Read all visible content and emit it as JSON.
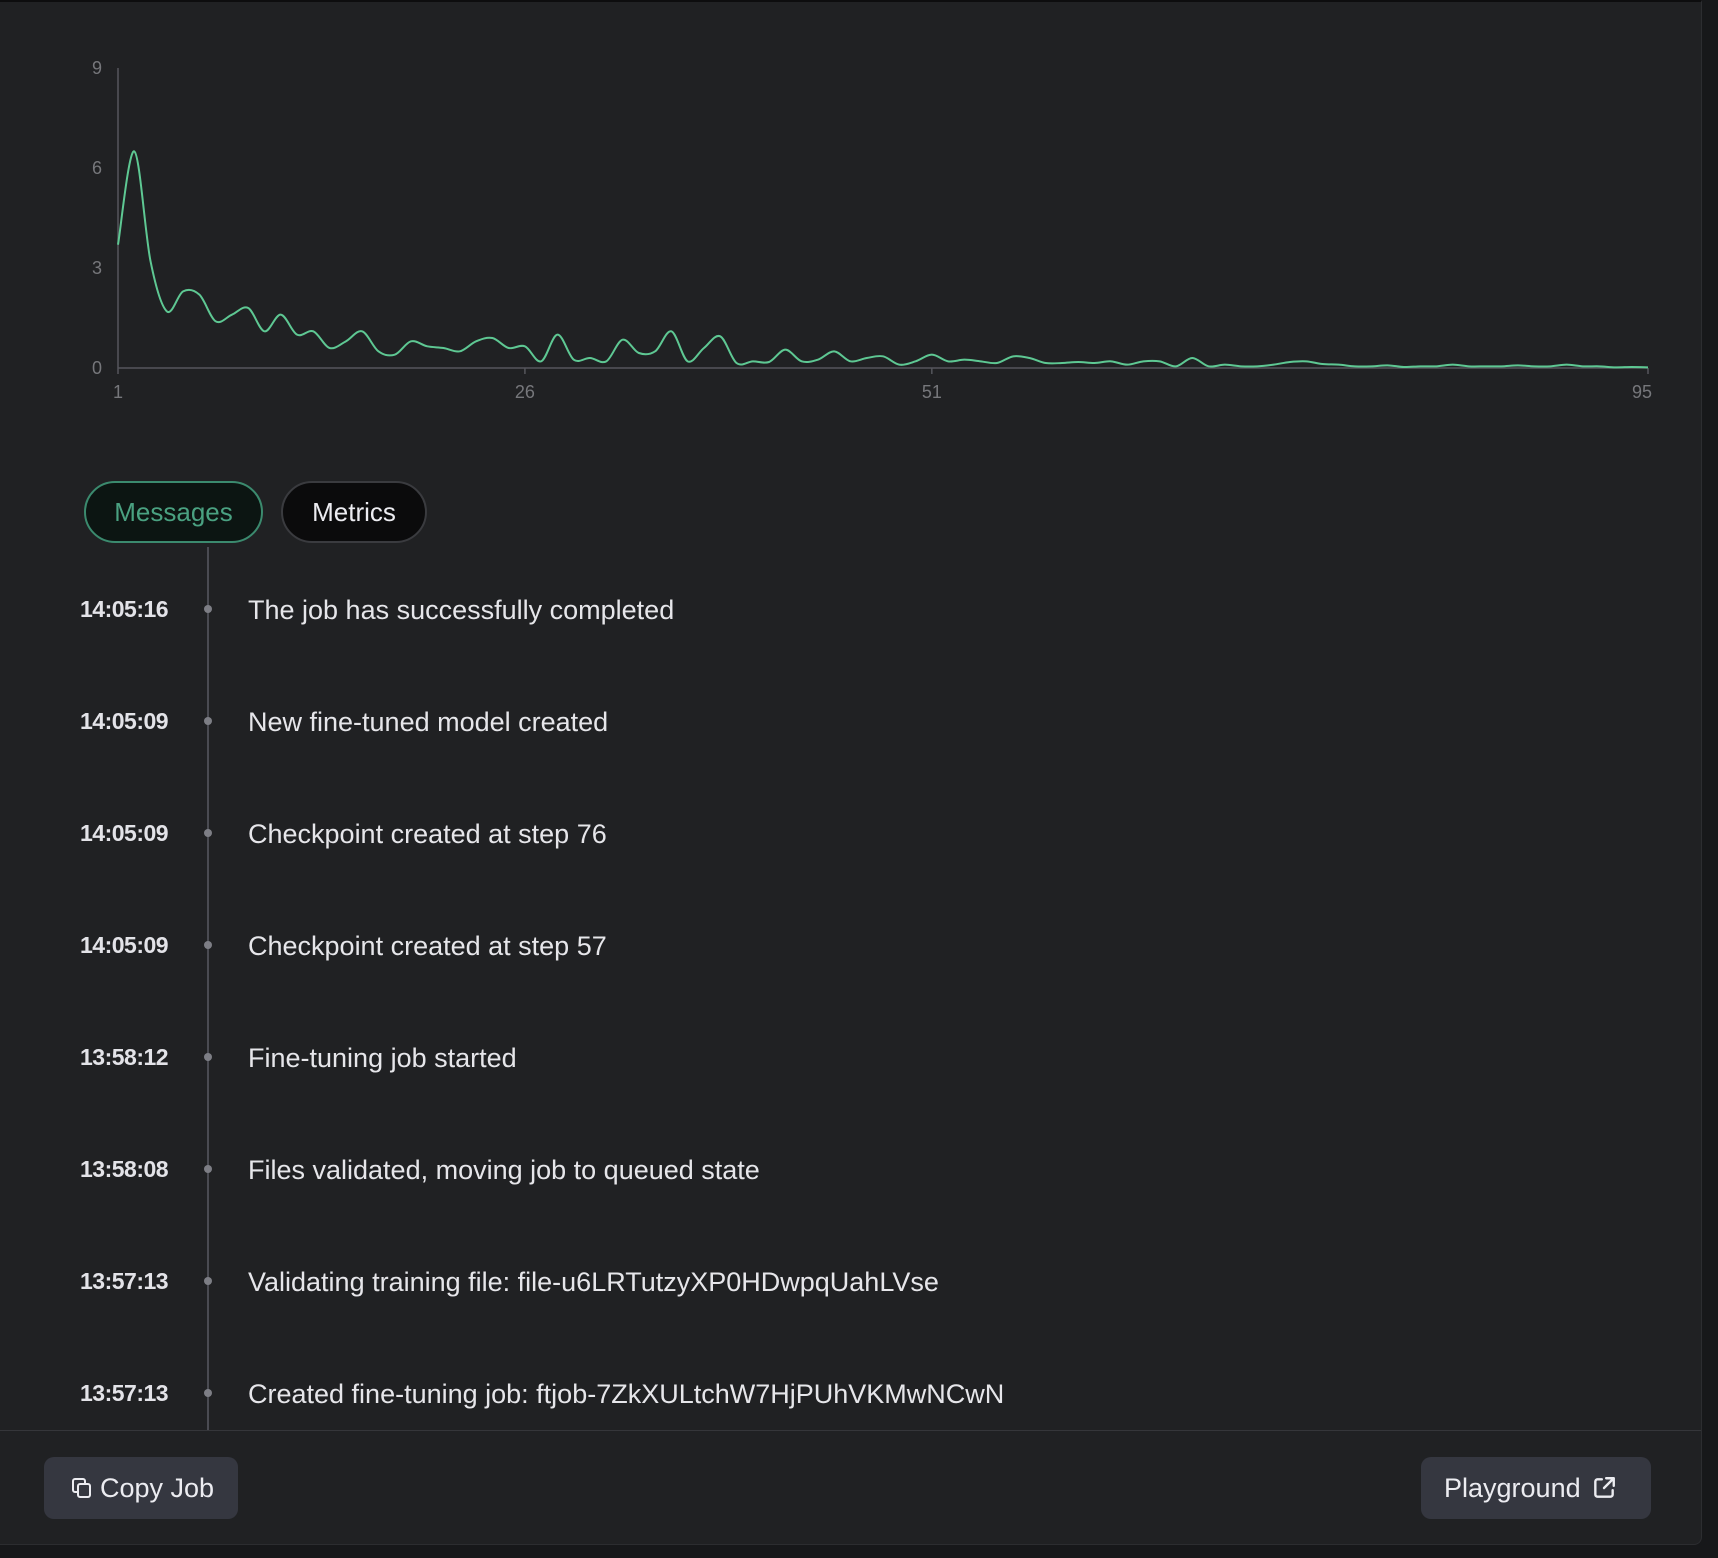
{
  "chart_data": {
    "type": "line",
    "title": "",
    "xlabel": "",
    "ylabel": "",
    "xlim": [
      1,
      95
    ],
    "ylim": [
      0,
      9
    ],
    "x_ticks": [
      "1",
      "26",
      "51",
      "95"
    ],
    "y_ticks": [
      "0",
      "3",
      "6",
      "9"
    ],
    "grid": false,
    "series": [
      {
        "color": "#5ec893",
        "x": [
          1,
          2,
          3,
          4,
          5,
          6,
          7,
          8,
          9,
          10,
          11,
          12,
          13,
          14,
          15,
          16,
          17,
          18,
          19,
          20,
          21,
          22,
          23,
          24,
          25,
          26,
          27,
          28,
          29,
          30,
          31,
          32,
          33,
          34,
          35,
          36,
          37,
          38,
          39,
          40,
          41,
          42,
          43,
          44,
          45,
          46,
          47,
          48,
          49,
          50,
          51,
          52,
          53,
          54,
          55,
          56,
          57,
          58,
          59,
          60,
          61,
          62,
          63,
          64,
          65,
          66,
          67,
          68,
          69,
          70,
          71,
          72,
          73,
          74,
          75,
          76,
          77,
          78,
          79,
          80,
          81,
          82,
          83,
          84,
          85,
          86,
          87,
          88,
          89,
          90,
          91,
          92,
          93,
          94,
          95
        ],
        "values": [
          3.7,
          6.5,
          3.2,
          1.7,
          2.3,
          2.2,
          1.4,
          1.6,
          1.8,
          1.1,
          1.6,
          1.0,
          1.1,
          0.6,
          0.8,
          1.1,
          0.5,
          0.4,
          0.8,
          0.65,
          0.6,
          0.5,
          0.8,
          0.9,
          0.6,
          0.65,
          0.2,
          1.0,
          0.25,
          0.3,
          0.2,
          0.85,
          0.45,
          0.5,
          1.1,
          0.2,
          0.6,
          0.95,
          0.15,
          0.2,
          0.18,
          0.55,
          0.2,
          0.25,
          0.5,
          0.2,
          0.3,
          0.35,
          0.1,
          0.2,
          0.4,
          0.2,
          0.25,
          0.2,
          0.15,
          0.35,
          0.3,
          0.15,
          0.15,
          0.18,
          0.15,
          0.2,
          0.1,
          0.2,
          0.2,
          0.05,
          0.3,
          0.05,
          0.1,
          0.05,
          0.05,
          0.1,
          0.18,
          0.2,
          0.12,
          0.1,
          0.05,
          0.05,
          0.08,
          0.03,
          0.05,
          0.05,
          0.1,
          0.05,
          0.05,
          0.05,
          0.08,
          0.05,
          0.05,
          0.1,
          0.05,
          0.05,
          0.02,
          0.03,
          0.02
        ]
      }
    ]
  },
  "tabs": {
    "messages": "Messages",
    "metrics": "Metrics"
  },
  "events": [
    {
      "time": "14:05:16",
      "message": "The job has successfully completed"
    },
    {
      "time": "14:05:09",
      "message": "New fine-tuned model created"
    },
    {
      "time": "14:05:09",
      "message": "Checkpoint created at step 76"
    },
    {
      "time": "14:05:09",
      "message": "Checkpoint created at step 57"
    },
    {
      "time": "13:58:12",
      "message": "Fine-tuning job started"
    },
    {
      "time": "13:58:08",
      "message": "Files validated, moving job to queued state"
    },
    {
      "time": "13:57:13",
      "message": "Validating training file: file-u6LRTutzyXP0HDwpqUahLVse"
    },
    {
      "time": "13:57:13",
      "message": "Created fine-tuning job: ftjob-7ZkXULtchW7HjPUhVKMwNCwN"
    }
  ],
  "footer": {
    "copy_label": "Copy Job",
    "copy_icon": "copy-icon",
    "playground_label": "Playground",
    "playground_icon": "external-link-icon"
  }
}
